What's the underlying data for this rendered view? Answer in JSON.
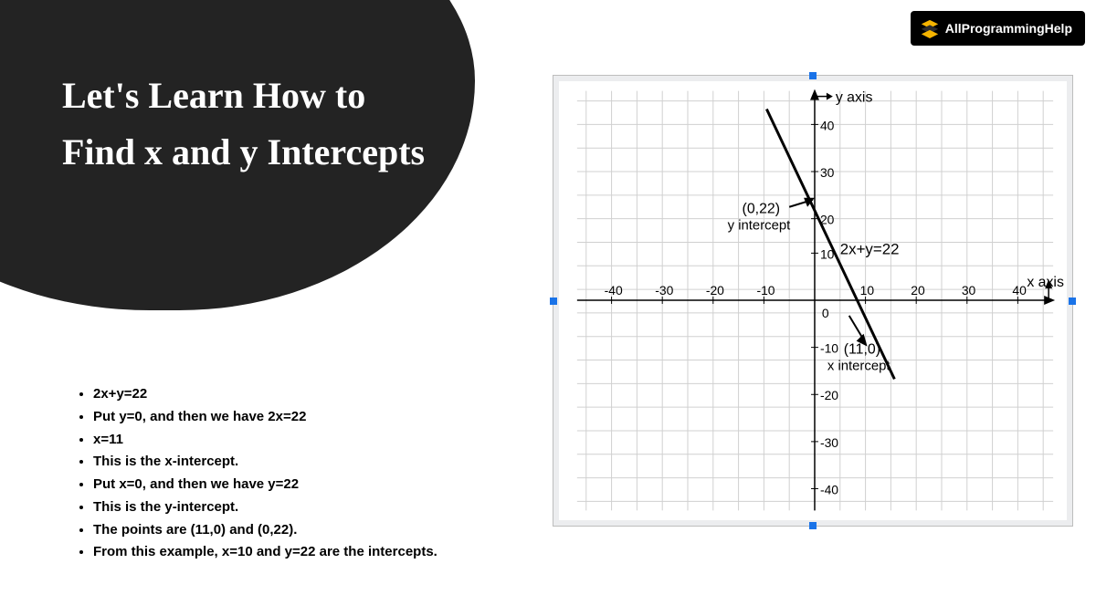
{
  "title": "Let's Learn How to Find x and y Intercepts",
  "brand": "AllProgrammingHelp",
  "steps": [
    "2x+y=22",
    "Put y=0, and then we have 2x=22",
    "x=11",
    "This is the x-intercept.",
    "Put x=0, and then we have y=22",
    "This is the y-intercept.",
    "The points are (11,0) and (0,22).",
    "From this example, x=10 and y=22 are the intercepts."
  ],
  "graph": {
    "y_axis_label": "y axis",
    "x_axis_label": "x axis",
    "equation": "2x+y=22",
    "y_intercept_label": "(0,22)",
    "y_intercept_text": "y intercept",
    "x_intercept_label": "(11,0)",
    "x_intercept_text": "x intercept",
    "x_ticks": [
      "-40",
      "-30",
      "-20",
      "-10",
      "10",
      "20",
      "30",
      "40"
    ],
    "y_ticks_pos": [
      "40",
      "30",
      "20",
      "10"
    ],
    "origin": "0",
    "y_ticks_neg": [
      "-10",
      "-20",
      "-30",
      "-40"
    ]
  },
  "chart_data": {
    "type": "line",
    "title": "2x+y=22",
    "xlabel": "x axis",
    "ylabel": "y axis",
    "xlim": [
      -45,
      45
    ],
    "ylim": [
      -45,
      45
    ],
    "x_ticks": [
      -40,
      -30,
      -20,
      -10,
      0,
      10,
      20,
      30,
      40
    ],
    "y_ticks": [
      -40,
      -30,
      -20,
      -10,
      0,
      10,
      20,
      30,
      40
    ],
    "series": [
      {
        "name": "2x+y=22",
        "x": [
          -5,
          20
        ],
        "y": [
          32,
          -18
        ]
      }
    ],
    "annotations": [
      {
        "text": "(0,22) y intercept",
        "x": 0,
        "y": 22
      },
      {
        "text": "(11,0) x intercept",
        "x": 11,
        "y": 0
      }
    ]
  }
}
